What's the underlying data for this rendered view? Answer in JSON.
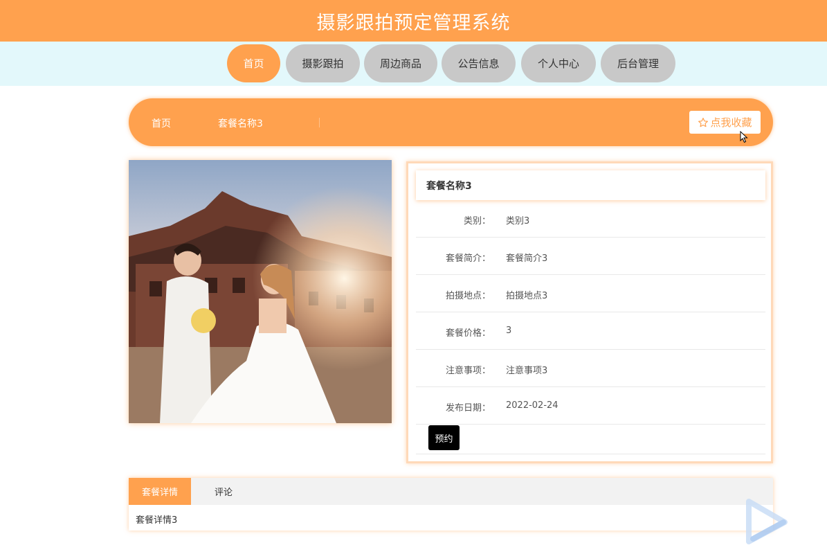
{
  "header": {
    "title": "摄影跟拍预定管理系统"
  },
  "nav": {
    "items": [
      {
        "label": "首页",
        "active": true
      },
      {
        "label": "摄影跟拍",
        "active": false
      },
      {
        "label": "周边商品",
        "active": false
      },
      {
        "label": "公告信息",
        "active": false
      },
      {
        "label": "个人中心",
        "active": false
      },
      {
        "label": "后台管理",
        "active": false
      }
    ]
  },
  "breadcrumb": {
    "home": "首页",
    "current": "套餐名称3",
    "favorite_label": "点我收藏",
    "favorite_icon": "star-outline-icon"
  },
  "detail": {
    "title": "套餐名称3",
    "rows": [
      {
        "label": "类别：",
        "value": "类别3"
      },
      {
        "label": "套餐简介：",
        "value": "套餐简介3"
      },
      {
        "label": "拍摄地点：",
        "value": "拍摄地点3"
      },
      {
        "label": "套餐价格：",
        "value": "3"
      },
      {
        "label": "注意事项：",
        "value": "注意事项3"
      },
      {
        "label": "发布日期：",
        "value": "2022-02-24"
      }
    ],
    "book_label": "预约"
  },
  "tabs": {
    "items": [
      {
        "label": "套餐详情",
        "active": true
      },
      {
        "label": "评论",
        "active": false
      }
    ],
    "content": "套餐详情3"
  },
  "colors": {
    "accent": "#ffa14e",
    "nav_bg": "#e3f8fb",
    "nav_inactive": "#c8c8c8"
  }
}
